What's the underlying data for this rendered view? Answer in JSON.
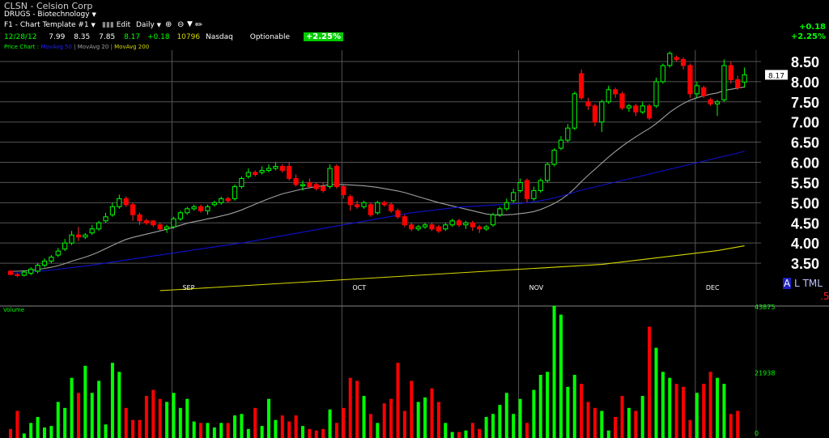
{
  "header": {
    "symbol_line": "CLSN - Celsion Corp",
    "industry": "DRUGS - Biotechnology",
    "template": "F1 - Chart Template #1",
    "edit_label": "Edit",
    "period": "Daily",
    "change_abs": "+0.18",
    "change_pct": "+2.25%"
  },
  "quote": {
    "date": "12/28/12",
    "open": "7.99",
    "high": "8.35",
    "low": "7.85",
    "close": "8.17",
    "change": "+0.18",
    "volume": "10796",
    "exchange": "Nasdaq",
    "optionable": "Optionable",
    "pct_badge": "+2.25%"
  },
  "legend": {
    "price_chart": "Price Chart :",
    "ma50": "MovAvg 50",
    "ma20": "MovAvg 20",
    "ma200": "MovAvg 200"
  },
  "right_controls": {
    "a": "A",
    "l": "L",
    "tml": "TML",
    "step": ".5"
  },
  "volume_label": "Volume",
  "colors": {
    "up": "#00ff00",
    "down": "#ff0000",
    "ma20": "#a0a0a0",
    "ma50": "#1010d0",
    "ma200": "#d8d800",
    "grid": "#555555",
    "accent_green": "#00ff00"
  },
  "chart_data": [
    {
      "type": "candlestick",
      "title": "CLSN - Celsion Corp",
      "y_ticks": [
        3.5,
        4.0,
        4.5,
        5.0,
        5.5,
        6.0,
        6.5,
        7.0,
        7.5,
        8.0,
        8.5
      ],
      "ylim": [
        3.1,
        8.7
      ],
      "x_ticks": [
        {
          "label": "SEP",
          "index": 24
        },
        {
          "label": "OCT",
          "index": 49
        },
        {
          "label": "NOV",
          "index": 75
        },
        {
          "label": "DEC",
          "index": 101
        }
      ],
      "last_price_label": "8.17",
      "candles": [
        [
          3.3,
          3.22,
          3.33,
          3.2
        ],
        [
          3.22,
          3.2,
          3.26,
          3.15
        ],
        [
          3.2,
          3.28,
          3.32,
          3.17
        ],
        [
          3.25,
          3.35,
          3.4,
          3.2
        ],
        [
          3.3,
          3.45,
          3.5,
          3.25
        ],
        [
          3.45,
          3.55,
          3.62,
          3.4
        ],
        [
          3.55,
          3.65,
          3.7,
          3.5
        ],
        [
          3.7,
          3.8,
          3.88,
          3.65
        ],
        [
          3.85,
          4.0,
          4.1,
          3.8
        ],
        [
          4.0,
          4.2,
          4.3,
          3.95
        ],
        [
          4.2,
          4.15,
          4.4,
          4.05
        ],
        [
          4.15,
          4.2,
          4.25,
          4.1
        ],
        [
          4.25,
          4.35,
          4.45,
          4.2
        ],
        [
          4.35,
          4.5,
          4.55,
          4.3
        ],
        [
          4.55,
          4.65,
          4.75,
          4.5
        ],
        [
          4.7,
          4.9,
          5.0,
          4.65
        ],
        [
          4.9,
          5.1,
          5.2,
          4.85
        ],
        [
          5.1,
          4.95,
          5.15,
          4.9
        ],
        [
          4.95,
          4.7,
          5.0,
          4.55
        ],
        [
          4.7,
          4.55,
          4.75,
          4.45
        ],
        [
          4.55,
          4.5,
          4.6,
          4.45
        ],
        [
          4.55,
          4.45,
          4.55,
          4.4
        ],
        [
          4.45,
          4.35,
          4.5,
          4.3
        ],
        [
          4.35,
          4.4,
          4.45,
          4.25
        ],
        [
          4.4,
          4.6,
          4.65,
          4.35
        ],
        [
          4.6,
          4.75,
          4.8,
          4.55
        ],
        [
          4.75,
          4.85,
          4.9,
          4.7
        ],
        [
          4.85,
          4.9,
          4.95,
          4.8
        ],
        [
          4.9,
          4.8,
          4.95,
          4.75
        ],
        [
          4.8,
          4.9,
          4.95,
          4.7
        ],
        [
          4.95,
          5.0,
          5.05,
          4.9
        ],
        [
          5.0,
          5.1,
          5.15,
          4.95
        ],
        [
          5.1,
          5.05,
          5.15,
          5.0
        ],
        [
          5.1,
          5.4,
          5.45,
          5.05
        ],
        [
          5.4,
          5.6,
          5.65,
          5.35
        ],
        [
          5.65,
          5.75,
          5.85,
          5.6
        ],
        [
          5.75,
          5.7,
          5.8,
          5.65
        ],
        [
          5.75,
          5.8,
          5.9,
          5.7
        ],
        [
          5.8,
          5.85,
          5.95,
          5.75
        ],
        [
          5.85,
          5.9,
          6.0,
          5.8
        ],
        [
          5.9,
          5.8,
          5.95,
          5.75
        ],
        [
          5.9,
          5.6,
          6.0,
          5.55
        ],
        [
          5.6,
          5.45,
          5.7,
          5.4
        ],
        [
          5.45,
          5.45,
          5.55,
          5.3
        ],
        [
          5.5,
          5.4,
          5.6,
          5.35
        ],
        [
          5.45,
          5.35,
          5.5,
          5.3
        ],
        [
          5.4,
          5.3,
          5.5,
          5.25
        ],
        [
          5.4,
          5.85,
          5.95,
          5.35
        ],
        [
          5.9,
          5.4,
          5.95,
          5.35
        ],
        [
          5.4,
          5.2,
          5.45,
          5.1
        ],
        [
          5.15,
          4.95,
          5.2,
          4.8
        ],
        [
          4.95,
          4.9,
          5.05,
          4.85
        ],
        [
          4.9,
          5.0,
          5.05,
          4.85
        ],
        [
          4.95,
          4.7,
          5.0,
          4.65
        ],
        [
          4.75,
          5.0,
          5.05,
          4.7
        ],
        [
          5.0,
          4.95,
          5.05,
          4.9
        ],
        [
          4.95,
          4.8,
          5.0,
          4.75
        ],
        [
          4.8,
          4.65,
          4.85,
          4.6
        ],
        [
          4.65,
          4.45,
          4.7,
          4.4
        ],
        [
          4.45,
          4.35,
          4.5,
          4.3
        ],
        [
          4.35,
          4.4,
          4.45,
          4.3
        ],
        [
          4.4,
          4.45,
          4.5,
          4.35
        ],
        [
          4.45,
          4.35,
          4.5,
          4.3
        ],
        [
          4.4,
          4.3,
          4.45,
          4.25
        ],
        [
          4.35,
          4.45,
          4.5,
          4.3
        ],
        [
          4.45,
          4.55,
          4.6,
          4.4
        ],
        [
          4.55,
          4.45,
          4.6,
          4.4
        ],
        [
          4.45,
          4.5,
          4.55,
          4.35
        ],
        [
          4.5,
          4.4,
          4.55,
          4.3
        ],
        [
          4.4,
          4.35,
          4.45,
          4.25
        ],
        [
          4.35,
          4.4,
          4.45,
          4.3
        ],
        [
          4.45,
          4.7,
          4.75,
          4.4
        ],
        [
          4.7,
          4.85,
          4.9,
          4.65
        ],
        [
          4.85,
          5.0,
          5.1,
          4.8
        ],
        [
          5.05,
          5.25,
          5.35,
          5.0
        ],
        [
          5.3,
          5.5,
          5.6,
          5.25
        ],
        [
          5.55,
          5.1,
          5.6,
          5.0
        ],
        [
          5.1,
          5.3,
          5.4,
          5.05
        ],
        [
          5.3,
          5.55,
          5.6,
          5.25
        ],
        [
          5.55,
          5.95,
          6.0,
          5.5
        ],
        [
          5.95,
          6.3,
          6.35,
          5.9
        ],
        [
          6.35,
          6.55,
          6.65,
          6.3
        ],
        [
          6.55,
          6.85,
          6.95,
          6.5
        ],
        [
          6.85,
          7.7,
          7.75,
          6.8
        ],
        [
          8.2,
          7.6,
          8.3,
          7.55
        ],
        [
          7.5,
          7.4,
          7.6,
          7.3
        ],
        [
          7.4,
          7.0,
          7.45,
          6.9
        ],
        [
          7.0,
          7.5,
          7.55,
          6.75
        ],
        [
          7.5,
          7.8,
          7.9,
          7.45
        ],
        [
          7.8,
          7.7,
          7.85,
          7.6
        ],
        [
          7.7,
          7.35,
          7.75,
          7.3
        ],
        [
          7.35,
          7.4,
          7.45,
          7.25
        ],
        [
          7.4,
          7.25,
          7.45,
          7.15
        ],
        [
          7.25,
          7.4,
          7.5,
          7.2
        ],
        [
          7.4,
          7.1,
          7.45,
          7.05
        ],
        [
          7.4,
          8.0,
          8.1,
          7.35
        ],
        [
          8.0,
          8.4,
          8.45,
          7.95
        ],
        [
          8.4,
          8.7,
          8.75,
          8.35
        ],
        [
          8.6,
          8.55,
          8.65,
          8.5
        ],
        [
          8.55,
          8.4,
          8.6,
          8.3
        ],
        [
          8.4,
          7.7,
          8.45,
          7.6
        ],
        [
          7.7,
          7.9,
          8.0,
          7.6
        ],
        [
          7.85,
          7.65,
          7.9,
          7.6
        ],
        [
          7.55,
          7.45,
          7.6,
          7.4
        ],
        [
          7.45,
          7.5,
          7.55,
          7.15
        ],
        [
          7.55,
          8.4,
          8.55,
          7.5
        ],
        [
          8.4,
          8.05,
          8.5,
          7.95
        ],
        [
          8.05,
          7.85,
          8.15,
          7.8
        ],
        [
          7.99,
          8.17,
          8.35,
          7.85
        ]
      ],
      "series": [
        {
          "name": "MovAvg 20",
          "values": [
            3.3,
            3.3,
            3.31,
            3.32,
            3.34,
            3.37,
            3.4,
            3.44,
            3.49,
            3.55,
            3.6,
            3.65,
            3.71,
            3.78,
            3.86,
            3.94,
            4.02,
            4.09,
            4.14,
            4.18,
            4.22,
            4.26,
            4.3,
            4.34,
            4.39,
            4.44,
            4.49,
            4.53,
            4.56,
            4.6,
            4.63,
            4.67,
            4.71,
            4.76,
            4.82,
            4.89,
            4.96,
            5.03,
            5.1,
            5.16,
            5.22,
            5.26,
            5.3,
            5.34,
            5.37,
            5.4,
            5.42,
            5.45,
            5.45,
            5.45,
            5.44,
            5.43,
            5.42,
            5.4,
            5.38,
            5.35,
            5.32,
            5.29,
            5.25,
            5.2,
            5.15,
            5.1,
            5.05,
            5.0,
            4.96,
            4.92,
            4.88,
            4.84,
            4.8,
            4.76,
            4.72,
            4.7,
            4.69,
            4.7,
            4.71,
            4.73,
            4.75,
            4.78,
            4.83,
            4.9,
            4.98,
            5.08,
            5.2,
            5.35,
            5.52,
            5.68,
            5.83,
            5.98,
            6.13,
            6.27,
            6.4,
            6.52,
            6.63,
            6.74,
            6.84,
            6.96,
            7.1,
            7.24,
            7.36,
            7.46,
            7.54,
            7.6,
            7.65,
            7.69,
            7.72,
            7.78,
            7.81,
            7.84,
            7.87
          ]
        },
        {
          "name": "MovAvg 50",
          "values": [
            3.25,
            3.26,
            3.27,
            3.28,
            3.3,
            3.31,
            3.33,
            3.35,
            3.37,
            3.39,
            3.41,
            3.43,
            3.45,
            3.48,
            3.5,
            3.53,
            3.55,
            3.58,
            3.6,
            3.63,
            3.65,
            3.68,
            3.7,
            3.73,
            3.75,
            3.78,
            3.8,
            3.83,
            3.85,
            3.88,
            3.9,
            3.93,
            3.95,
            3.98,
            4.0,
            4.03,
            4.06,
            4.09,
            4.12,
            4.15,
            4.18,
            4.21,
            4.24,
            4.27,
            4.3,
            4.33,
            4.36,
            4.39,
            4.42,
            4.45,
            4.48,
            4.51,
            4.54,
            4.57,
            4.6,
            4.63,
            4.66,
            4.69,
            4.72,
            4.75,
            4.77,
            4.79,
            4.81,
            4.83,
            4.85,
            4.87,
            4.89,
            4.9,
            4.91,
            4.92,
            4.93,
            4.94,
            4.95,
            4.96,
            4.97,
            4.98,
            5.0,
            5.02,
            5.05,
            5.08,
            5.12,
            5.16,
            5.21,
            5.26,
            5.31,
            5.35,
            5.39,
            5.43,
            5.47,
            5.51,
            5.55,
            5.59,
            5.63,
            5.67,
            5.71,
            5.75,
            5.79,
            5.83,
            5.87,
            5.91,
            5.95,
            5.99,
            6.03,
            6.07,
            6.11,
            6.15,
            6.19,
            6.23,
            6.28
          ]
        },
        {
          "name": "MovAvg 200",
          "values": [
            null,
            null,
            null,
            null,
            null,
            null,
            null,
            null,
            null,
            null,
            null,
            null,
            null,
            null,
            null,
            null,
            null,
            null,
            null,
            null,
            null,
            null,
            2.82,
            2.83,
            2.84,
            2.85,
            2.86,
            2.87,
            2.88,
            2.89,
            2.9,
            2.91,
            2.92,
            2.93,
            2.94,
            2.95,
            2.96,
            2.97,
            2.98,
            2.99,
            3.0,
            3.01,
            3.02,
            3.03,
            3.04,
            3.05,
            3.06,
            3.07,
            3.08,
            3.09,
            3.1,
            3.11,
            3.12,
            3.13,
            3.14,
            3.15,
            3.16,
            3.17,
            3.18,
            3.19,
            3.2,
            3.21,
            3.22,
            3.23,
            3.24,
            3.25,
            3.26,
            3.27,
            3.28,
            3.29,
            3.3,
            3.31,
            3.32,
            3.33,
            3.34,
            3.35,
            3.36,
            3.37,
            3.38,
            3.39,
            3.4,
            3.41,
            3.42,
            3.43,
            3.44,
            3.45,
            3.46,
            3.47,
            3.49,
            3.51,
            3.53,
            3.55,
            3.57,
            3.59,
            3.61,
            3.63,
            3.65,
            3.67,
            3.69,
            3.71,
            3.73,
            3.75,
            3.77,
            3.79,
            3.81,
            3.84,
            3.87,
            3.9,
            3.93
          ]
        }
      ]
    },
    {
      "type": "bar",
      "title": "Volume",
      "y_ticks": [
        0,
        21938,
        43875
      ],
      "ylim": [
        0,
        43875
      ],
      "values": [
        3000,
        9000,
        1500,
        5000,
        7000,
        3500,
        4000,
        12000,
        10000,
        20000,
        15000,
        24000,
        15000,
        19000,
        4500,
        25000,
        22000,
        10000,
        6000,
        6000,
        14000,
        16000,
        13000,
        12000,
        15000,
        10000,
        13000,
        5500,
        5000,
        5000,
        3500,
        5000,
        5000,
        7500,
        8000,
        3000,
        10000,
        4000,
        13000,
        6000,
        7500,
        5500,
        7500,
        4000,
        3000,
        2500,
        3000,
        9500,
        5000,
        10000,
        20000,
        19000,
        14000,
        8000,
        5000,
        11500,
        13000,
        25000,
        9000,
        19000,
        12000,
        13500,
        16500,
        12000,
        5000,
        2000,
        2000,
        2500,
        5000,
        3000,
        7000,
        8000,
        11000,
        15000,
        8000,
        13000,
        5000,
        16000,
        21000,
        22000,
        44000,
        41000,
        17000,
        21000,
        18000,
        12000,
        10000,
        9000,
        2500,
        7000,
        14000,
        10000,
        9000,
        14000,
        37000,
        30000,
        22000,
        20000,
        18000,
        17000,
        6000,
        15000,
        18000,
        22000,
        20000,
        18000,
        8000,
        9000
      ]
    }
  ]
}
